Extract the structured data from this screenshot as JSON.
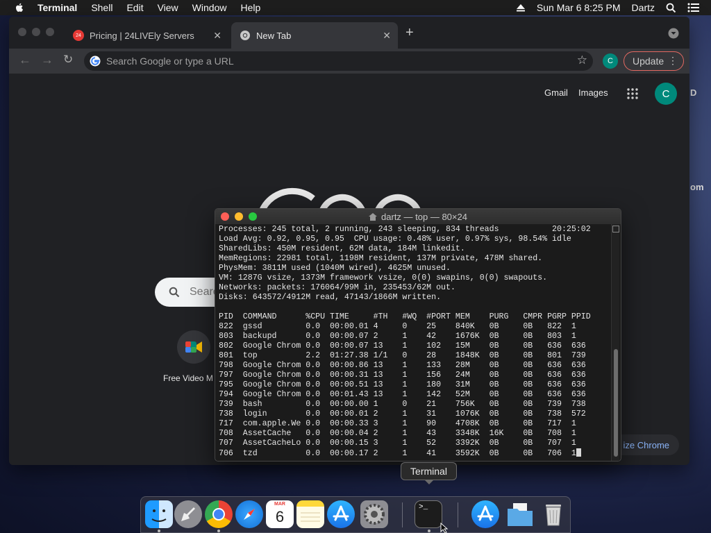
{
  "menubar": {
    "app": "Terminal",
    "items": [
      "Shell",
      "Edit",
      "View",
      "Window",
      "Help"
    ],
    "datetime": "Sun Mar 6  8:25 PM",
    "user": "Dartz"
  },
  "wallpaper": {
    "text_top": "D",
    "text_mid": "om"
  },
  "chrome": {
    "tabs": [
      {
        "title": "Pricing | 24LIVEly Servers",
        "favicon_text": "24"
      },
      {
        "title": "New Tab"
      }
    ],
    "omnibox_placeholder": "Search Google or type a URL",
    "profile_initial": "C",
    "update_label": "Update",
    "ntp": {
      "gmail": "Gmail",
      "images": "Images",
      "avatar_initial": "C",
      "search_placeholder": "Searc",
      "shortcut_label": "Free Video M",
      "customize_label": "ize Chrome"
    }
  },
  "terminal": {
    "title": "dartz — top — 80×24",
    "lines": [
      "Processes: 245 total, 2 running, 243 sleeping, 834 threads           20:25:02",
      "Load Avg: 0.92, 0.95, 0.95  CPU usage: 0.48% user, 0.97% sys, 98.54% idle",
      "SharedLibs: 450M resident, 62M data, 184M linkedit.",
      "MemRegions: 22981 total, 1198M resident, 137M private, 478M shared.",
      "PhysMem: 3811M used (1040M wired), 4625M unused.",
      "VM: 1287G vsize, 1373M framework vsize, 0(0) swapins, 0(0) swapouts.",
      "Networks: packets: 176064/99M in, 235453/62M out.",
      "Disks: 643572/4912M read, 47143/1866M written.",
      "",
      "PID  COMMAND      %CPU TIME     #TH   #WQ  #PORT MEM    PURG   CMPR PGRP PPID",
      "822  gssd         0.0  00:00.01 4     0    25    840K   0B     0B   822  1",
      "803  backupd      0.0  00:00.07 2     1    42    1676K  0B     0B   803  1",
      "802  Google Chrom 0.0  00:00.07 13    1    102   15M    0B     0B   636  636",
      "801  top          2.2  01:27.38 1/1   0    28    1848K  0B     0B   801  739",
      "798  Google Chrom 0.0  00:00.86 13    1    133   28M    0B     0B   636  636",
      "797  Google Chrom 0.0  00:00.31 13    1    156   24M    0B     0B   636  636",
      "795  Google Chrom 0.0  00:00.51 13    1    180   31M    0B     0B   636  636",
      "794  Google Chrom 0.0  00:01.43 13    1    142   52M    0B     0B   636  636",
      "739  bash         0.0  00:00.00 1     0    21    756K   0B     0B   739  738",
      "738  login        0.0  00:00.01 2     1    31    1076K  0B     0B   738  572",
      "717  com.apple.We 0.0  00:00.33 3     1    90    4708K  0B     0B   717  1",
      "708  AssetCache   0.0  00:00.04 2     1    43    3348K  16K    0B   708  1",
      "707  AssetCacheLo 0.0  00:00.15 3     1    52    3392K  0B     0B   707  1",
      "706  tzd          0.0  00:00.17 2     1    41    3592K  0B     0B   706  1"
    ]
  },
  "dock": {
    "tooltip": "Terminal",
    "calendar_month": "MAR",
    "calendar_day": "6",
    "apps": [
      "Finder",
      "Launchpad",
      "Google Chrome",
      "Safari",
      "Calendar",
      "Notes",
      "App Store",
      "System Preferences",
      "Terminal",
      "Applications",
      "Documents",
      "Trash"
    ]
  },
  "colors": {
    "accent_blue": "#8ab4f8",
    "avatar_teal": "#00897b",
    "update_border": "#e46962",
    "traffic_red": "#ff5f57",
    "traffic_yellow": "#febc2e",
    "traffic_green": "#28c840"
  }
}
